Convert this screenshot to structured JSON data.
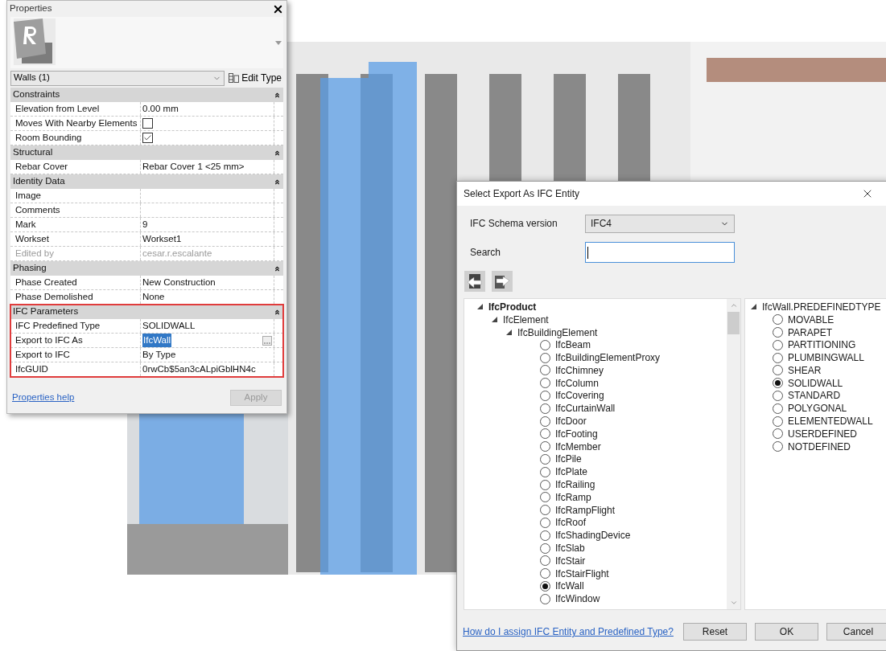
{
  "properties": {
    "title": "Properties",
    "type_selector": "Walls (1)",
    "edit_type": "Edit Type",
    "groups": [
      {
        "name": "Constraints",
        "highlighted": false,
        "rows": [
          {
            "label": "Elevation from Level",
            "kind": "text",
            "value": "0.00 mm"
          },
          {
            "label": "Moves With Nearby Elements",
            "kind": "checkbox",
            "checked": false
          },
          {
            "label": "Room Bounding",
            "kind": "checkbox",
            "checked": true
          }
        ]
      },
      {
        "name": "Structural",
        "highlighted": false,
        "rows": [
          {
            "label": "Rebar Cover",
            "kind": "text",
            "value": "Rebar Cover 1 <25 mm>"
          }
        ]
      },
      {
        "name": "Identity Data",
        "highlighted": false,
        "rows": [
          {
            "label": "Image",
            "kind": "text"
          },
          {
            "label": "Comments",
            "kind": "text"
          },
          {
            "label": "Mark",
            "kind": "text",
            "value": "9"
          },
          {
            "label": "Workset",
            "kind": "text",
            "value": "Workset1"
          },
          {
            "label": "Edited by",
            "kind": "text",
            "value": "cesar.r.escalante",
            "disabled": true
          }
        ]
      },
      {
        "name": "Phasing",
        "highlighted": false,
        "rows": [
          {
            "label": "Phase Created",
            "kind": "text",
            "value": "New Construction"
          },
          {
            "label": "Phase Demolished",
            "kind": "text",
            "value": "None"
          }
        ]
      },
      {
        "name": "IFC Parameters",
        "highlighted": true,
        "rows": [
          {
            "label": "IFC Predefined Type",
            "kind": "text",
            "value": "SOLIDWALL"
          },
          {
            "label": "Export to IFC As",
            "kind": "browse",
            "value": "IfcWall",
            "selected": true
          },
          {
            "label": "Export to IFC",
            "kind": "text",
            "value": "By Type"
          },
          {
            "label": "IfcGUID",
            "kind": "text",
            "value": "0rwCb$5an3cALpiGblHN4c"
          }
        ]
      }
    ],
    "help_link": "Properties help",
    "apply_button": {
      "label": "Apply",
      "disabled": true
    }
  },
  "dialog": {
    "title": "Select Export As IFC Entity",
    "schema_label": "IFC Schema version",
    "schema_value": "IFC4",
    "search_label": "Search",
    "tree": [
      {
        "label": "IfcProduct",
        "bold": true,
        "expanded": true,
        "children": [
          {
            "label": "IfcElement",
            "bold": false,
            "expanded": true,
            "children": [
              {
                "label": "IfcBuildingElement",
                "bold": false,
                "expanded": true,
                "children": [
                  {
                    "label": "IfcBeam",
                    "selected": false
                  },
                  {
                    "label": "IfcBuildingElementProxy",
                    "selected": false
                  },
                  {
                    "label": "IfcChimney",
                    "selected": false
                  },
                  {
                    "label": "IfcColumn",
                    "selected": false
                  },
                  {
                    "label": "IfcCovering",
                    "selected": false
                  },
                  {
                    "label": "IfcCurtainWall",
                    "selected": false
                  },
                  {
                    "label": "IfcDoor",
                    "selected": false
                  },
                  {
                    "label": "IfcFooting",
                    "selected": false
                  },
                  {
                    "label": "IfcMember",
                    "selected": false
                  },
                  {
                    "label": "IfcPile",
                    "selected": false
                  },
                  {
                    "label": "IfcPlate",
                    "selected": false
                  },
                  {
                    "label": "IfcRailing",
                    "selected": false
                  },
                  {
                    "label": "IfcRamp",
                    "selected": false
                  },
                  {
                    "label": "IfcRampFlight",
                    "selected": false
                  },
                  {
                    "label": "IfcRoof",
                    "selected": false
                  },
                  {
                    "label": "IfcShadingDevice",
                    "selected": false
                  },
                  {
                    "label": "IfcSlab",
                    "selected": false
                  },
                  {
                    "label": "IfcStair",
                    "selected": false
                  },
                  {
                    "label": "IfcStairFlight",
                    "selected": false
                  },
                  {
                    "label": "IfcWall",
                    "selected": true
                  },
                  {
                    "label": "IfcWindow",
                    "selected": false
                  }
                ]
              }
            ]
          }
        ]
      }
    ],
    "predefined": {
      "label": "IfcWall.PREDEFINEDTYPE",
      "expanded": true,
      "options": [
        {
          "label": "MOVABLE",
          "selected": false
        },
        {
          "label": "PARAPET",
          "selected": false
        },
        {
          "label": "PARTITIONING",
          "selected": false
        },
        {
          "label": "PLUMBINGWALL",
          "selected": false
        },
        {
          "label": "SHEAR",
          "selected": false
        },
        {
          "label": "SOLIDWALL",
          "selected": true
        },
        {
          "label": "STANDARD",
          "selected": false
        },
        {
          "label": "POLYGONAL",
          "selected": false
        },
        {
          "label": "ELEMENTEDWALL",
          "selected": false
        },
        {
          "label": "USERDEFINED",
          "selected": false
        },
        {
          "label": "NOTDEFINED",
          "selected": false
        }
      ]
    },
    "help_link": "How do I assign IFC Entity and Predefined Type?",
    "buttons": [
      "Reset",
      "OK",
      "Cancel"
    ]
  }
}
